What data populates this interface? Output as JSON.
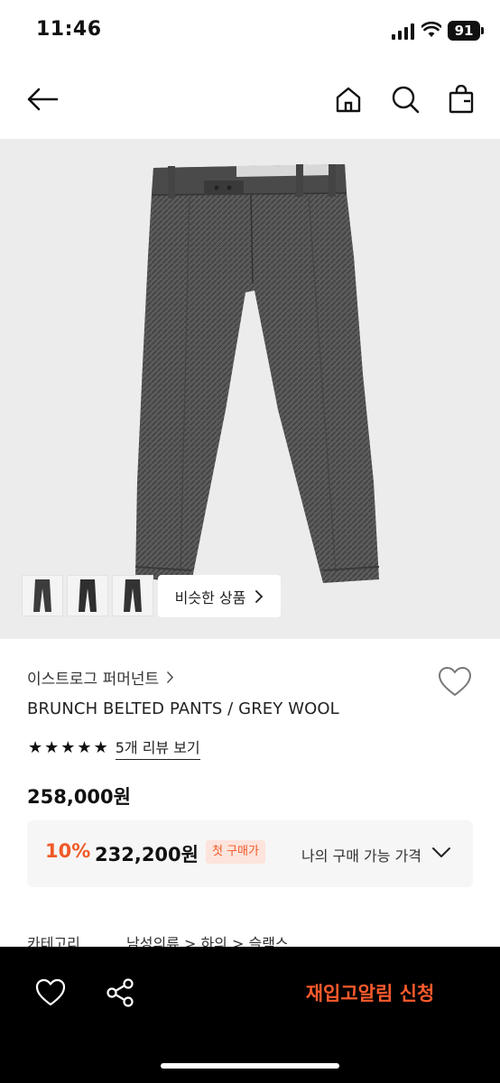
{
  "status_bar": {
    "time": "11:46",
    "battery": "91"
  },
  "product": {
    "brand": "이스트로그 퍼머넌트",
    "name": "BRUNCH BELTED PANTS / GREY WOOL",
    "rating_stars": 5,
    "review_link": "5개 리뷰 보기",
    "price": "258,000원",
    "image": {
      "description_icon": "pants-photo"
    }
  },
  "gallery": {
    "similar_button": "비슷한 상품",
    "thumbnail_count": 3
  },
  "price_box": {
    "discount": "10%",
    "sale_price": "232,200원",
    "badge": "첫 구매가",
    "my_price_label": "나의 구매 가능 가격"
  },
  "category": {
    "label": "카테고리",
    "path": "남성의류 > 하의 > 슬랙스"
  },
  "bottom_bar": {
    "restock_button": "재입고알림 신청"
  },
  "colors": {
    "accent": "#f05a28",
    "badge_bg": "#fde4dc",
    "bottom_bar_bg": "#000000",
    "image_bg": "#ececec"
  }
}
